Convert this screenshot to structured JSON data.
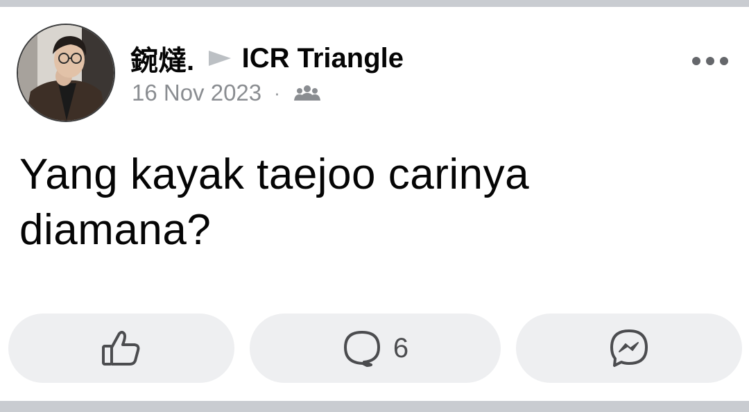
{
  "post": {
    "author": "鋺燵.",
    "group": "ICR Triangle",
    "date": "16 Nov 2023",
    "separator": "·",
    "audience_icon": "group-icon",
    "text_line1": "Yang kayak taejoo carinya",
    "text_line2": "diamana?"
  },
  "actions": {
    "like_icon": "thumbs-up-icon",
    "comment_icon": "comment-bubble-icon",
    "comment_count": "6",
    "share_icon": "messenger-icon"
  },
  "colors": {
    "text": "#050505",
    "meta": "#8a8d91",
    "button_bg": "#eeeff1",
    "divider": "#c9ccd1"
  }
}
